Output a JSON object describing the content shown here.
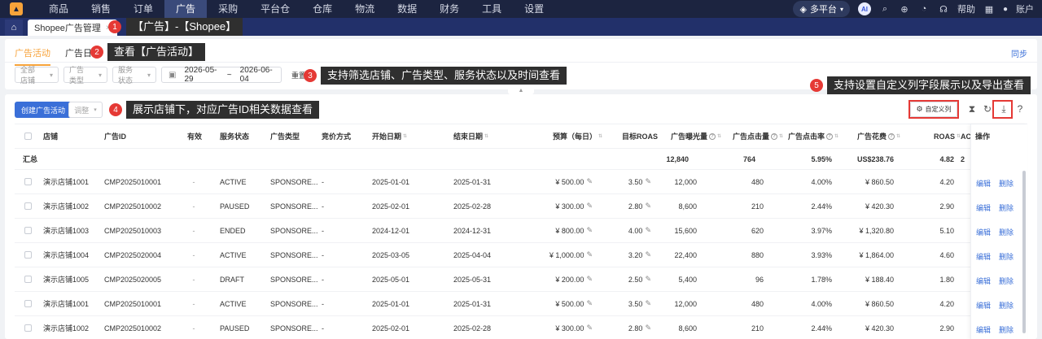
{
  "nav": {
    "items": [
      "商品",
      "销售",
      "订单",
      "广告",
      "采购",
      "平台仓",
      "仓库",
      "物流",
      "数据",
      "财务",
      "工具",
      "设置"
    ],
    "active_index": 3,
    "platform": "多平台",
    "ai": "AI",
    "help": "帮助",
    "account": "账户"
  },
  "tabs": {
    "page_tab": "Shopee广告管理",
    "close": "×"
  },
  "callouts": [
    {
      "num": "1",
      "text": "【广告】-【Shopee】"
    },
    {
      "num": "2",
      "text": "查看【广告活动】"
    },
    {
      "num": "3",
      "text": "支持筛选店铺、广告类型、服务状态以及时间查看"
    },
    {
      "num": "4",
      "text": "展示店铺下，对应广告ID相关数据查看"
    },
    {
      "num": "5",
      "text": "支持设置自定义列字段展示以及导出查看"
    }
  ],
  "subtabs": [
    "广告活动",
    "广告日志"
  ],
  "sync": "同步",
  "filters": {
    "shop": "全部店铺",
    "ad_type": "广告类型",
    "service_status": "服务状态",
    "date_start": "2026-05-29",
    "date_sep": "~",
    "date_end": "2026-06-04",
    "reset": "重置"
  },
  "toolbar": {
    "create": "创建广告活动",
    "adjust": "调整",
    "custom_columns": "自定义列"
  },
  "table": {
    "headers": [
      "店铺",
      "广告ID",
      "有效",
      "服务状态",
      "广告类型",
      "竞价方式",
      "开始日期",
      "结束日期",
      "预算（每日）",
      "目标ROAS",
      "广告曝光量",
      "广告点击量",
      "广告点击率",
      "广告花费",
      "ROAS",
      "AC",
      "操作"
    ],
    "summary": {
      "label": "汇总",
      "impressions": "12,840",
      "clicks": "764",
      "ctr": "5.95%",
      "spend": "US$238.76",
      "roas": "4.82",
      "ac": "2"
    },
    "ops": [
      "编辑",
      "删除"
    ],
    "rows": [
      {
        "shop": "演示店铺1001",
        "id": "CMP2025010001",
        "valid": "-",
        "status": "ACTIVE",
        "type": "SPONSORE...",
        "bid": "-",
        "start": "2025-01-01",
        "end": "2025-01-31",
        "budget": "¥ 500.00",
        "troas": "3.50",
        "impr": "12,000",
        "clicks": "480",
        "ctr": "4.00%",
        "spend": "¥ 860.50",
        "roas": "4.20"
      },
      {
        "shop": "演示店铺1002",
        "id": "CMP2025010002",
        "valid": "-",
        "status": "PAUSED",
        "type": "SPONSORE...",
        "bid": "-",
        "start": "2025-02-01",
        "end": "2025-02-28",
        "budget": "¥ 300.00",
        "troas": "2.80",
        "impr": "8,600",
        "clicks": "210",
        "ctr": "2.44%",
        "spend": "¥ 420.30",
        "roas": "2.90"
      },
      {
        "shop": "演示店铺1003",
        "id": "CMP2025010003",
        "valid": "-",
        "status": "ENDED",
        "type": "SPONSORE...",
        "bid": "-",
        "start": "2024-12-01",
        "end": "2024-12-31",
        "budget": "¥ 800.00",
        "troas": "4.00",
        "impr": "15,600",
        "clicks": "620",
        "ctr": "3.97%",
        "spend": "¥ 1,320.80",
        "roas": "5.10"
      },
      {
        "shop": "演示店铺1004",
        "id": "CMP2025020004",
        "valid": "-",
        "status": "ACTIVE",
        "type": "SPONSORE...",
        "bid": "-",
        "start": "2025-03-05",
        "end": "2025-04-04",
        "budget": "¥ 1,000.00",
        "troas": "3.20",
        "impr": "22,400",
        "clicks": "880",
        "ctr": "3.93%",
        "spend": "¥ 1,864.00",
        "roas": "4.60"
      },
      {
        "shop": "演示店铺1005",
        "id": "CMP2025020005",
        "valid": "-",
        "status": "DRAFT",
        "type": "SPONSORE...",
        "bid": "-",
        "start": "2025-05-01",
        "end": "2025-05-31",
        "budget": "¥ 200.00",
        "troas": "2.50",
        "impr": "5,400",
        "clicks": "96",
        "ctr": "1.78%",
        "spend": "¥ 188.40",
        "roas": "1.80"
      },
      {
        "shop": "演示店铺1001",
        "id": "CMP2025010001",
        "valid": "-",
        "status": "ACTIVE",
        "type": "SPONSORE...",
        "bid": "-",
        "start": "2025-01-01",
        "end": "2025-01-31",
        "budget": "¥ 500.00",
        "troas": "3.50",
        "impr": "12,000",
        "clicks": "480",
        "ctr": "4.00%",
        "spend": "¥ 860.50",
        "roas": "4.20"
      },
      {
        "shop": "演示店铺1002",
        "id": "CMP2025010002",
        "valid": "-",
        "status": "PAUSED",
        "type": "SPONSORE...",
        "bid": "-",
        "start": "2025-02-01",
        "end": "2025-02-28",
        "budget": "¥ 300.00",
        "troas": "2.80",
        "impr": "8,600",
        "clicks": "210",
        "ctr": "2.44%",
        "spend": "¥ 420.30",
        "roas": "2.90"
      }
    ]
  },
  "colors": {
    "nav_bg": "#1c2440",
    "tab_bg": "#22306a",
    "accent_orange": "#f7a33a",
    "primary_blue": "#3a6fd8",
    "callout_red": "#e53935"
  }
}
